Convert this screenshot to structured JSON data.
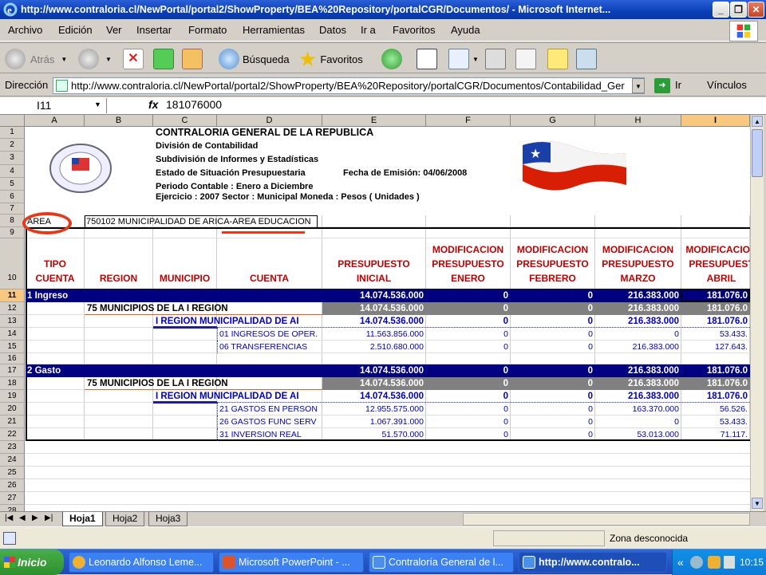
{
  "window": {
    "title": "http://www.contraloria.cl/NewPortal/portal2/ShowProperty/BEA%20Repository/portalCGR/Documentos/ - Microsoft Internet..."
  },
  "menu": [
    "Archivo",
    "Edición",
    "Ver",
    "Insertar",
    "Formato",
    "Herramientas",
    "Datos",
    "Ir a",
    "Favoritos",
    "Ayuda"
  ],
  "toolbar": {
    "back": "Atrás",
    "search": "Búsqueda",
    "favorites": "Favoritos"
  },
  "address": {
    "label": "Dirección",
    "url": "http://www.contraloria.cl/NewPortal/portal2/ShowProperty/BEA%20Repository/portalCGR/Documentos/Contabilidad_Ger",
    "go": "Ir",
    "links": "Vínculos"
  },
  "formula": {
    "cell": "I11",
    "fx": "fx",
    "value": "181076000"
  },
  "columns": [
    "A",
    "B",
    "C",
    "D",
    "E",
    "F",
    "G",
    "H",
    "I"
  ],
  "rows": [
    "1",
    "2",
    "3",
    "4",
    "5",
    "6",
    "7",
    "8",
    "9",
    "10",
    "11",
    "12",
    "13",
    "14",
    "15",
    "16",
    "17",
    "18",
    "19",
    "20",
    "21",
    "22",
    "23",
    "24",
    "25",
    "26",
    "27",
    "28"
  ],
  "header_block": {
    "line1": "CONTRALORIA GENERAL DE LA REPUBLICA",
    "line2": "División de Contabilidad",
    "line3": "Subdivisión de Informes y Estadísticas",
    "line4a": "Estado de Situación Presupuestaria",
    "line4b": "Fecha de Emisión:  04/06/2008",
    "line5": "Periodo Contable : Enero a Diciembre",
    "line6": "Ejercicio : 2007    Sector : Municipal    Moneda : Pesos ( Unidades )"
  },
  "area": {
    "label": "AREA",
    "value": "750102 MUNICIPALIDAD DE ARICA-AREA EDUCACION"
  },
  "table_headers": {
    "tipo": "TIPO\nCUENTA",
    "region": "REGION",
    "municipio": "MUNICIPIO",
    "cuenta": "CUENTA",
    "e": "PRESUPUESTO\nINICIAL",
    "f": "MODIFICACION\nPRESUPUESTO\nENERO",
    "g": "MODIFICACION\nPRESUPUESTO\nFEBRERO",
    "h": "MODIFICACION\nPRESUPUESTO\nMARZO",
    "i": "MODIFICACION\nPRESUPUEST\nABRIL"
  },
  "data_rows": [
    {
      "row": "11",
      "style": "navy",
      "a": "1 Ingreso",
      "b": "",
      "c": "",
      "d": "",
      "e": "14.074.536.000",
      "f": "0",
      "g": "0",
      "h": "216.383.000",
      "i": "181.076.0"
    },
    {
      "row": "12",
      "style": "gray",
      "a": "",
      "b": "75 MUNICIPIOS DE LA I REGION",
      "c": "",
      "d": "",
      "e": "14.074.536.000",
      "f": "0",
      "g": "0",
      "h": "216.383.000",
      "i": "181.076.0"
    },
    {
      "row": "13",
      "style": "blue",
      "a": "",
      "b": "",
      "c": "I REGION MUNICIPALIDAD DE AI",
      "d": "",
      "e": "14.074.536.000",
      "f": "0",
      "g": "0",
      "h": "216.383.000",
      "i": "181.076.0"
    },
    {
      "row": "14",
      "style": "plain",
      "a": "",
      "b": "",
      "c": "",
      "d": "01 INGRESOS DE OPER.",
      "e": "11.563.856.000",
      "f": "0",
      "g": "0",
      "h": "0",
      "i": "53.433."
    },
    {
      "row": "15",
      "style": "plain",
      "a": "",
      "b": "",
      "c": "",
      "d": "06 TRANSFERENCIAS",
      "e": "2.510.680.000",
      "f": "0",
      "g": "0",
      "h": "216.383.000",
      "i": "127.643."
    },
    {
      "row": "17",
      "style": "navy",
      "a": "2 Gasto",
      "b": "",
      "c": "",
      "d": "",
      "e": "14.074.536.000",
      "f": "0",
      "g": "0",
      "h": "216.383.000",
      "i": "181.076.0"
    },
    {
      "row": "18",
      "style": "gray",
      "a": "",
      "b": "75 MUNICIPIOS DE LA I REGION",
      "c": "",
      "d": "",
      "e": "14.074.536.000",
      "f": "0",
      "g": "0",
      "h": "216.383.000",
      "i": "181.076.0"
    },
    {
      "row": "19",
      "style": "blue",
      "a": "",
      "b": "",
      "c": "I REGION MUNICIPALIDAD DE AI",
      "d": "",
      "e": "14.074.536.000",
      "f": "0",
      "g": "0",
      "h": "216.383.000",
      "i": "181.076.0"
    },
    {
      "row": "20",
      "style": "plain",
      "a": "",
      "b": "",
      "c": "",
      "d": "21 GASTOS EN PERSON",
      "e": "12.955.575.000",
      "f": "0",
      "g": "0",
      "h": "163.370.000",
      "i": "56.526."
    },
    {
      "row": "21",
      "style": "plain",
      "a": "",
      "b": "",
      "c": "",
      "d": "26 GASTOS FUNC SERV",
      "e": "1.067.391.000",
      "f": "0",
      "g": "0",
      "h": "0",
      "i": "53.433."
    },
    {
      "row": "22",
      "style": "plain",
      "a": "",
      "b": "",
      "c": "",
      "d": "31 INVERSION REAL",
      "e": "51.570.000",
      "f": "0",
      "g": "0",
      "h": "53.013.000",
      "i": "71.117."
    }
  ],
  "sheet_tabs": [
    "Hoja1",
    "Hoja2",
    "Hoja3"
  ],
  "status": {
    "zone": "Zona desconocida"
  },
  "taskbar": {
    "start": "Inicio",
    "tasks": [
      "Leonardo Alfonso Leme...",
      "Microsoft PowerPoint - ...",
      "Contraloría General de l...",
      "http://www.contralo..."
    ],
    "time": "10:15",
    "chev": "«"
  },
  "colors": {
    "navy": "#000080",
    "gray": "#808080",
    "red": "#c00000",
    "blue": "#0000c0"
  }
}
